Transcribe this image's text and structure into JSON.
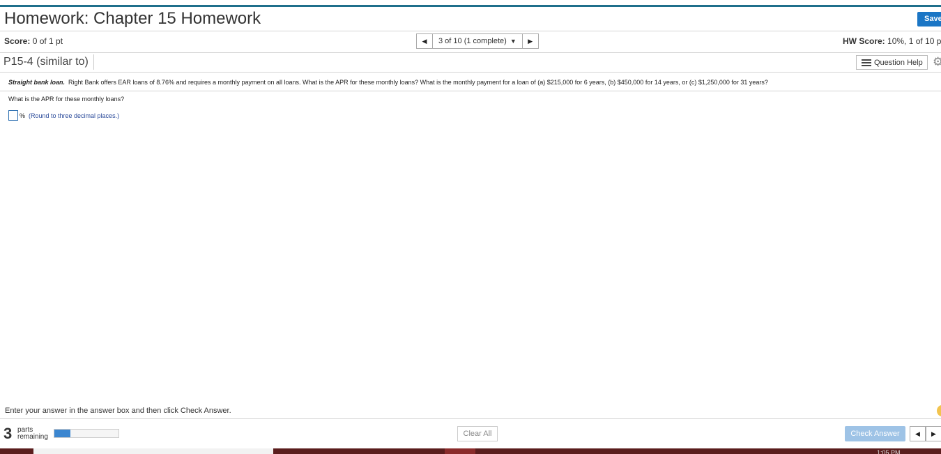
{
  "header": {
    "title": "Homework: Chapter 15 Homework",
    "save_label": "Save"
  },
  "score_bar": {
    "score_label": "Score:",
    "score_value": "0 of 1 pt",
    "nav_position": "3 of 10 (1 complete)",
    "hw_score_label": "HW Score:",
    "hw_score_value": "10%, 1 of 10 p"
  },
  "problem": {
    "id": "P15-4 (similar to)",
    "help_label": "Question Help",
    "lead": "Straight bank loan.",
    "text": "Right Bank offers EAR loans of 8.76% and requires a monthly payment on all loans.  What is the APR for these monthly loans?  What is the monthly payment for a loan of (a) $215,000 for 6 years, (b) $450,000 for 14 years, or (c) $1,250,000 for 31 years?",
    "question": "What is the APR for these monthly loans?",
    "answer_unit": "%",
    "answer_hint": "(Round to three decimal places.)"
  },
  "footer": {
    "instruction": "Enter your answer in the answer box and then click Check Answer.",
    "parts_count": "3",
    "parts_label_1": "parts",
    "parts_label_2": "remaining",
    "progress_fraction": 0.25,
    "clear_label": "Clear All",
    "check_label": "Check Answer"
  },
  "taskbar": {
    "clock": "1:05 PM"
  },
  "colors": {
    "accent": "#1b76c5",
    "header_line": "#1f6f8b",
    "check_disabled": "#9ec3e6",
    "taskbar": "#5a1d1d"
  }
}
